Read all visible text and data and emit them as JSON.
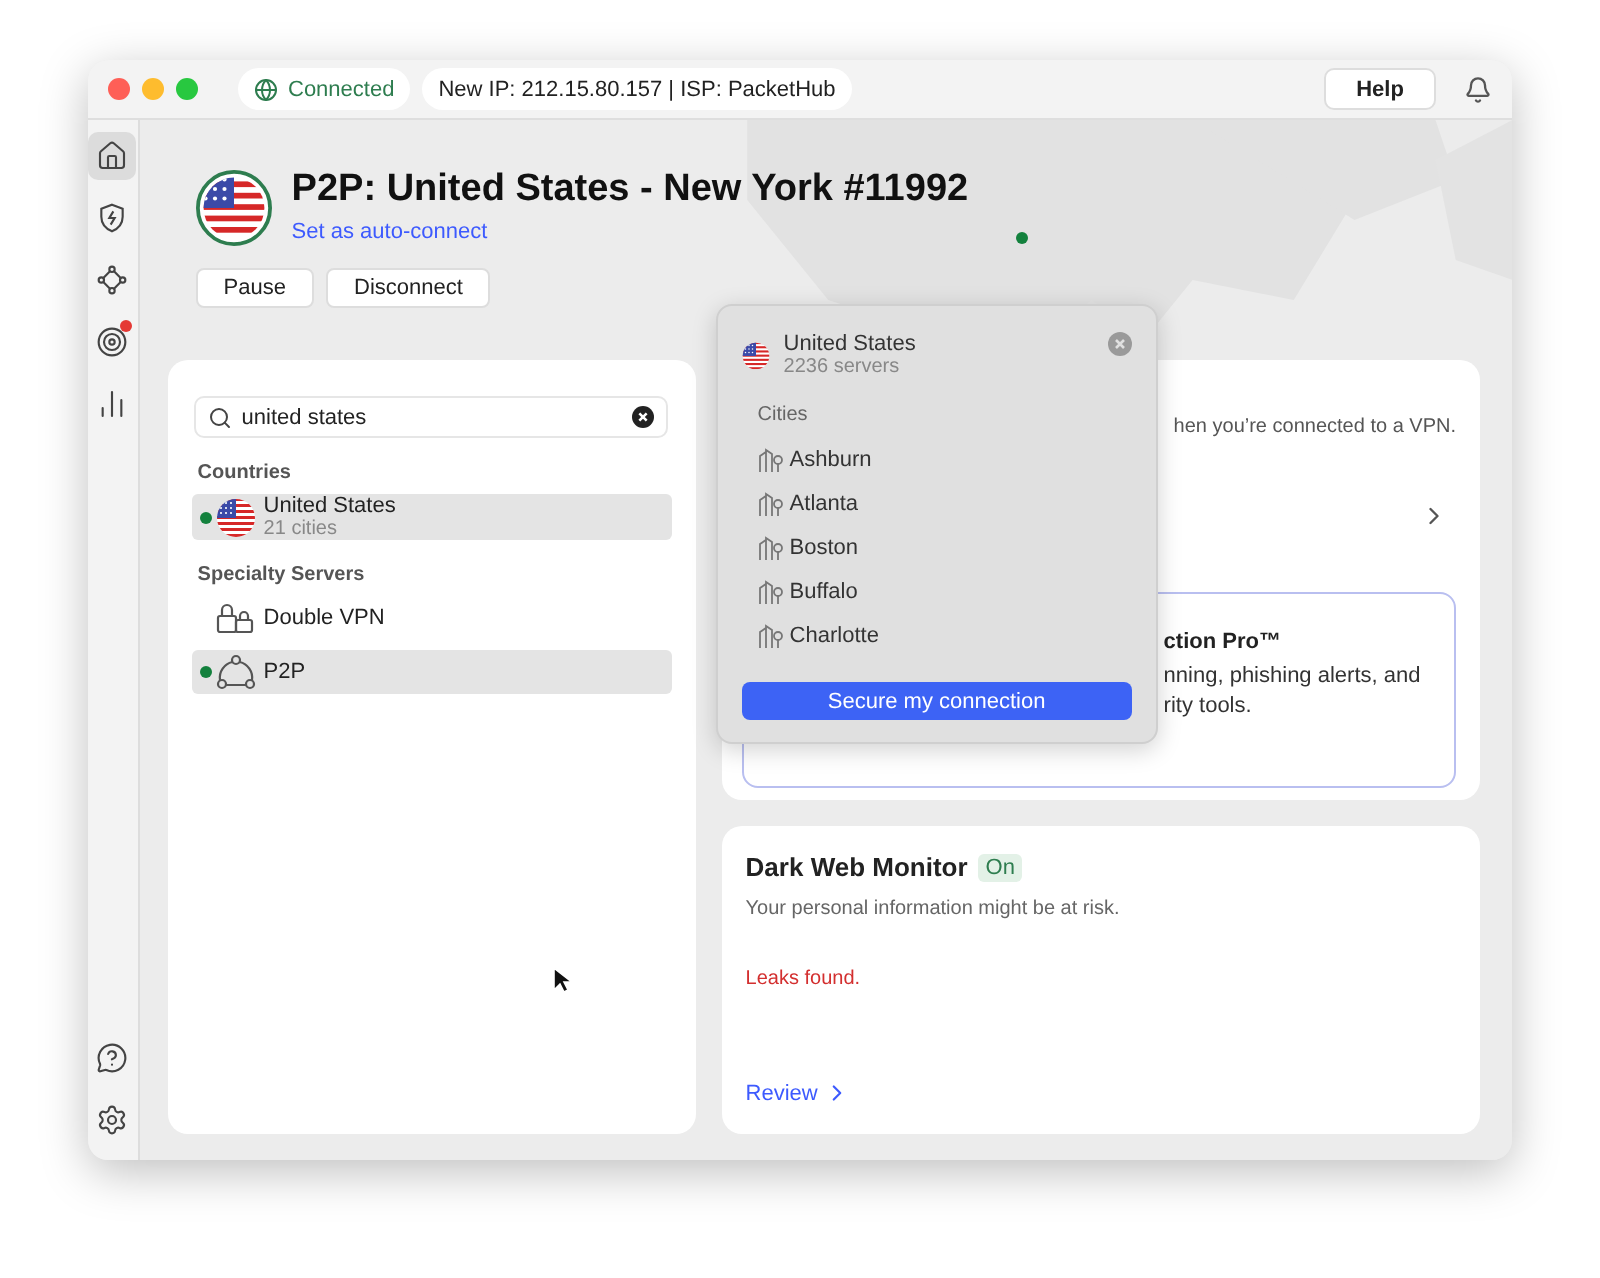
{
  "status": {
    "label": "Connected",
    "connected": true
  },
  "connection_info": "New IP: 212.15.80.157 | ISP: PacketHub",
  "help_button": "Help",
  "sidebar": {
    "items": [
      {
        "kind": "home",
        "selected": true,
        "badge": false
      },
      {
        "kind": "protection",
        "selected": false,
        "badge": false
      },
      {
        "kind": "meshnet",
        "selected": false,
        "badge": false
      },
      {
        "kind": "target",
        "selected": false,
        "badge": true
      },
      {
        "kind": "stats",
        "selected": false,
        "badge": false
      }
    ],
    "bottom_items": [
      {
        "kind": "help"
      },
      {
        "kind": "settings"
      }
    ]
  },
  "server": {
    "title": "P2P: United States - New York #11992",
    "link": "Set as auto-connect",
    "buttons": [
      "Pause",
      "Disconnect"
    ]
  },
  "search": {
    "value": "united states"
  },
  "sections": [
    {
      "heading": "Countries",
      "items": [
        {
          "kind": "country",
          "name": "United States",
          "detail": "21 cities",
          "selected": true,
          "connected": true
        }
      ]
    },
    {
      "heading": "Specialty Servers",
      "items": [
        {
          "kind": "double_vpn",
          "name": "Double VPN",
          "selected": false,
          "connected": false
        },
        {
          "kind": "p2p",
          "name": "P2P",
          "selected": true,
          "connected": true
        }
      ]
    }
  ],
  "popup": {
    "name": "United States",
    "detail": "2236 servers",
    "cities_heading": "Cities",
    "cities": [
      "Ashburn",
      "Atlanta",
      "Boston",
      "Buffalo",
      "Charlotte"
    ],
    "button": "Secure my connection"
  },
  "vpn_card": {
    "text": "hen you’re connected to a VPN."
  },
  "promo_card": {
    "title": "ction Pro™",
    "lines": [
      "nning, phishing alerts, and",
      "rity tools."
    ]
  },
  "dark_web": {
    "title": "Dark Web Monitor",
    "badge": "On",
    "text": "Your personal information might be at risk.",
    "alert": "Leaks found.",
    "link": "Review"
  }
}
